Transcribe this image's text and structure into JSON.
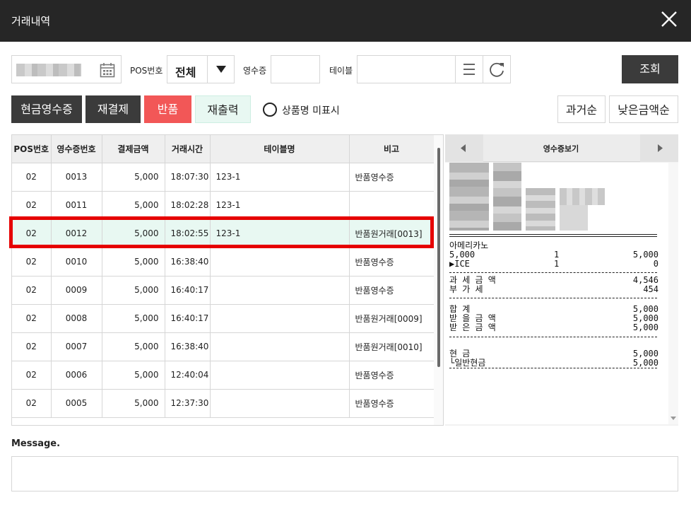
{
  "window": {
    "title": "거래내역"
  },
  "filters": {
    "pos_label": "POS번호",
    "pos_value": "전체",
    "receipt_label": "영수증",
    "receipt_value": "",
    "table_label": "테이블",
    "table_value": "",
    "search_label": "조회"
  },
  "actions": {
    "cash_receipt": "현금영수증",
    "repay": "재결제",
    "refund": "반품",
    "reprint": "재출력",
    "hide_product_name": "상품명 미표시",
    "sort_past": "과거순",
    "sort_low_amount": "낮은금액순"
  },
  "table": {
    "columns": [
      "POS번호",
      "영수증번호",
      "결제금액",
      "거래시간",
      "테이블명",
      "비고"
    ],
    "rows": [
      {
        "pos": "02",
        "receipt": "0013",
        "amount": "5,000",
        "time": "18:07:30",
        "table": "123-1",
        "note": "반품영수증"
      },
      {
        "pos": "02",
        "receipt": "0011",
        "amount": "5,000",
        "time": "18:02:28",
        "table": "123-1",
        "note": ""
      },
      {
        "pos": "02",
        "receipt": "0012",
        "amount": "5,000",
        "time": "18:02:55",
        "table": "123-1",
        "note": "반품원거래[0013]"
      },
      {
        "pos": "02",
        "receipt": "0010",
        "amount": "5,000",
        "time": "16:38:40",
        "table": "",
        "note": "반품영수증"
      },
      {
        "pos": "02",
        "receipt": "0009",
        "amount": "5,000",
        "time": "16:40:17",
        "table": "",
        "note": "반품영수증"
      },
      {
        "pos": "02",
        "receipt": "0008",
        "amount": "5,000",
        "time": "16:40:17",
        "table": "",
        "note": "반품원거래[0009]"
      },
      {
        "pos": "02",
        "receipt": "0007",
        "amount": "5,000",
        "time": "16:38:40",
        "table": "",
        "note": "반품원거래[0010]"
      },
      {
        "pos": "02",
        "receipt": "0006",
        "amount": "5,000",
        "time": "12:40:04",
        "table": "",
        "note": "반품영수증"
      },
      {
        "pos": "02",
        "receipt": "0005",
        "amount": "5,000",
        "time": "12:37:30",
        "table": "",
        "note": "반품영수증"
      }
    ],
    "selected_row": 2
  },
  "receipt": {
    "title": "영수증보기",
    "item_name": "아메리카노",
    "item": {
      "price": "5,000",
      "qty": "1",
      "total": "5,000"
    },
    "option": {
      "name": "▶ICE",
      "qty": "1",
      "total": "0"
    },
    "tax": [
      {
        "label": "과 세 금 액",
        "value": "4,546"
      },
      {
        "label": "부   가   세",
        "value": "454"
      }
    ],
    "sum": [
      {
        "label": "합        계",
        "value": "5,000"
      },
      {
        "label": "받 을 금 액",
        "value": "5,000"
      },
      {
        "label": "받 은 금 액",
        "value": "5,000"
      }
    ],
    "pay": [
      {
        "label": "현        금",
        "value": "5,000"
      },
      {
        "label": "└일반현금",
        "value": "5,000"
      }
    ]
  },
  "message": {
    "label": "Message.",
    "value": ""
  },
  "colors": {
    "titlebar": "#262626",
    "dark_button": "#3b3b3b",
    "refund_button": "#f25757",
    "reprint_button": "#e8f8f2",
    "selected_row": "#e8f8f2",
    "highlight_border": "#e60000"
  }
}
